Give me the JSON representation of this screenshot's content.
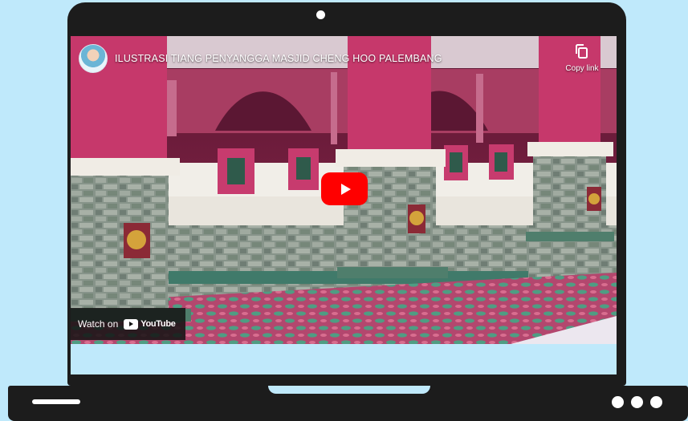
{
  "window": {
    "title": "ILUSTRASI TIANG PENYANGGA MASJID CHENG HOO PALEMBANG"
  },
  "player": {
    "title": "ILUSTRASI TIANG PENYANGGA MASJID CHENG HOO PALEMBANG",
    "copy_link": "Copy link",
    "watch_on": "Watch on",
    "platform": "YouTube",
    "play_label": "Play",
    "icons": {
      "avatar": "channel-avatar",
      "copy": "copy-link-icon",
      "play": "play-icon",
      "youtube": "youtube-logo-icon"
    }
  },
  "colors": {
    "page_background": "#bfe9fb",
    "laptop_frame": "#1c1c1c",
    "play_button": "#ff0000",
    "pillar_pink": "#c7386b",
    "stone_gray": "#8f9a8d"
  }
}
